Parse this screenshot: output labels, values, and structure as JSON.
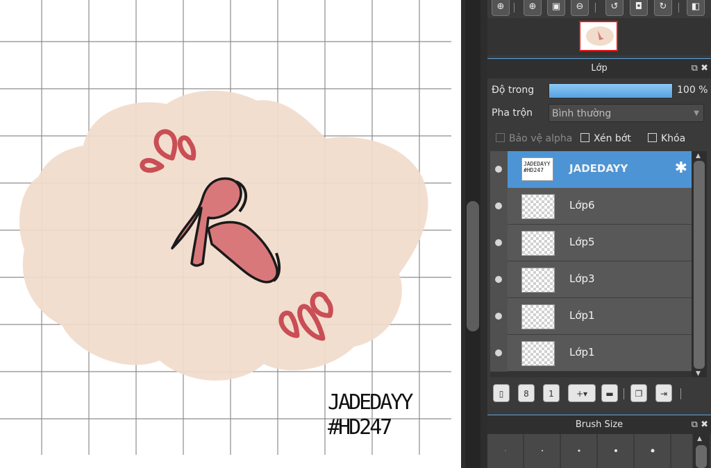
{
  "canvas": {
    "signature_line1": "JADEDAYY",
    "signature_line2": "#HD247",
    "letter": "h"
  },
  "toolbar": {
    "icons": [
      "zoom-reset-icon",
      "zoom-in-icon",
      "fit-screen-icon",
      "zoom-out-icon",
      "rotate-left-icon",
      "fit-page-icon",
      "rotate-right-icon",
      "flip-horizontal-icon"
    ]
  },
  "layer_panel": {
    "title": "Lớp",
    "opacity_label": "Độ trong",
    "opacity_value": "100 %",
    "opacity_fraction": 1.0,
    "blend_label": "Pha trộn",
    "blend_value": "Bình thường",
    "protect_alpha_label": "Bảo vệ alpha",
    "clipping_label": "Xén bớt",
    "lock_label": "Khóa",
    "layers": [
      {
        "name": "JADEDAYY",
        "selected": true,
        "thumb_text": "JADEDAYY #HD247"
      },
      {
        "name": "Lớp6",
        "selected": false
      },
      {
        "name": "Lớp5",
        "selected": false
      },
      {
        "name": "Lớp3",
        "selected": false
      },
      {
        "name": "Lớp1",
        "selected": false
      },
      {
        "name": "Lớp1",
        "selected": false
      }
    ]
  },
  "brush_panel": {
    "title": "Brush Size"
  },
  "colors": {
    "accent_blue": "#4d94d4",
    "blob": "#f1dccb",
    "letter_pink": "#d9787a",
    "drop_red": "#c94e55",
    "nav_highlight": "#e21b1b"
  }
}
